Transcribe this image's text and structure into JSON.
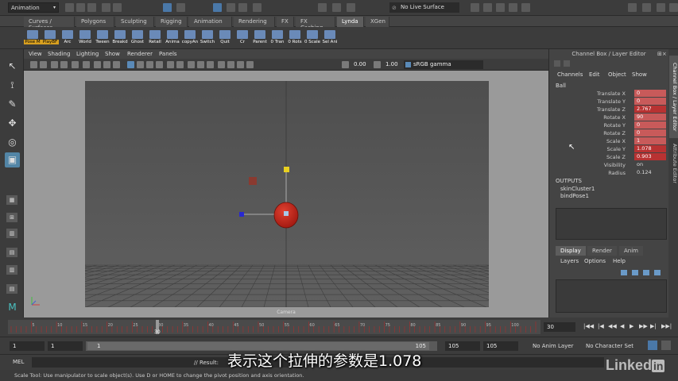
{
  "status_line": {
    "mode": "Animation",
    "live_surface": "No Live Surface"
  },
  "shelf": {
    "tabs": [
      "Curves / Surfaces",
      "Polygons",
      "Sculpting",
      "Rigging",
      "Animation",
      "Rendering",
      "FX",
      "FX Caching",
      "Lynda",
      "XGen"
    ],
    "active_tab": "Lynda",
    "buttons": [
      "Pose M",
      "PlayBF",
      "Arc",
      "World",
      "Tween",
      "Breakd",
      "Ghost",
      "Retall",
      "Anima",
      "copyAn",
      "Switch",
      "Quit",
      "Cr",
      "Parent",
      "0 Tran",
      "0 Rots",
      "0 Scale",
      "Sel Ani"
    ]
  },
  "viewport": {
    "menu": [
      "View",
      "Shading",
      "Lighting",
      "Show",
      "Renderer",
      "Panels"
    ],
    "field_a": "0.00",
    "field_b": "1.00",
    "color_space": "sRGB gamma",
    "camera_name": "Camera"
  },
  "channel_box": {
    "title": "Channel Box / Layer Editor",
    "menu": [
      "Channels",
      "Edit",
      "Object",
      "Show"
    ],
    "object": "Ball",
    "attributes": [
      {
        "label": "Translate X",
        "value": "0",
        "state": "keyed"
      },
      {
        "label": "Translate Y",
        "value": "0",
        "state": "keyed"
      },
      {
        "label": "Translate Z",
        "value": "2.767",
        "state": "selected"
      },
      {
        "label": "Rotate X",
        "value": "90",
        "state": "keyed"
      },
      {
        "label": "Rotate Y",
        "value": "0",
        "state": "keyed"
      },
      {
        "label": "Rotate Z",
        "value": "0",
        "state": "keyed"
      },
      {
        "label": "Scale X",
        "value": "1",
        "state": "keyed"
      },
      {
        "label": "Scale Y",
        "value": "1.078",
        "state": "selected"
      },
      {
        "label": "Scale Z",
        "value": "0.903",
        "state": "selected"
      },
      {
        "label": "Visibility",
        "value": "on",
        "state": "plain"
      },
      {
        "label": "Radius",
        "value": "0.124",
        "state": "plain"
      }
    ],
    "outputs_header": "OUTPUTS",
    "outputs": [
      "skinCluster1",
      "bindPose1"
    ],
    "side_tabs": [
      "Channel Box / Layer Editor",
      "Attribute Editor"
    ]
  },
  "layer_editor": {
    "tabs": [
      "Display",
      "Render",
      "Anim"
    ],
    "active_tab": "Display",
    "menu": [
      "Layers",
      "Options",
      "Help"
    ]
  },
  "time_slider": {
    "current_frame": "30",
    "marker": "30",
    "ticks": [
      "",
      "5",
      "10",
      "15",
      "20",
      "25",
      "30",
      "35",
      "40",
      "45",
      "50",
      "55",
      "60",
      "65",
      "70",
      "75",
      "80",
      "85",
      "90",
      "95",
      "100"
    ]
  },
  "range_slider": {
    "start": "1",
    "playback_start": "1",
    "slider_start": "1",
    "slider_end": "105",
    "playback_end": "105",
    "end": "105",
    "anim_layer": "No Anim Layer",
    "character_set": "No Character Set"
  },
  "command_line": {
    "label": "MEL",
    "result": "// Result:"
  },
  "help_line": "Scale Tool: Use manipulator to scale object(s). Use D or HOME to change the pivot position and axis orientation.",
  "subtitle": "表示这个拉伸的参数是1.078",
  "logo": {
    "text": "Linked",
    "badge": "in"
  },
  "colors": {
    "keyed": "#c85a5a",
    "selected": "#b83232",
    "ball": "#c0281c",
    "accent_blue": "#5285a6",
    "manip_x": "#c84040",
    "manip_y": "#e8d020",
    "manip_z": "#2828d0"
  }
}
